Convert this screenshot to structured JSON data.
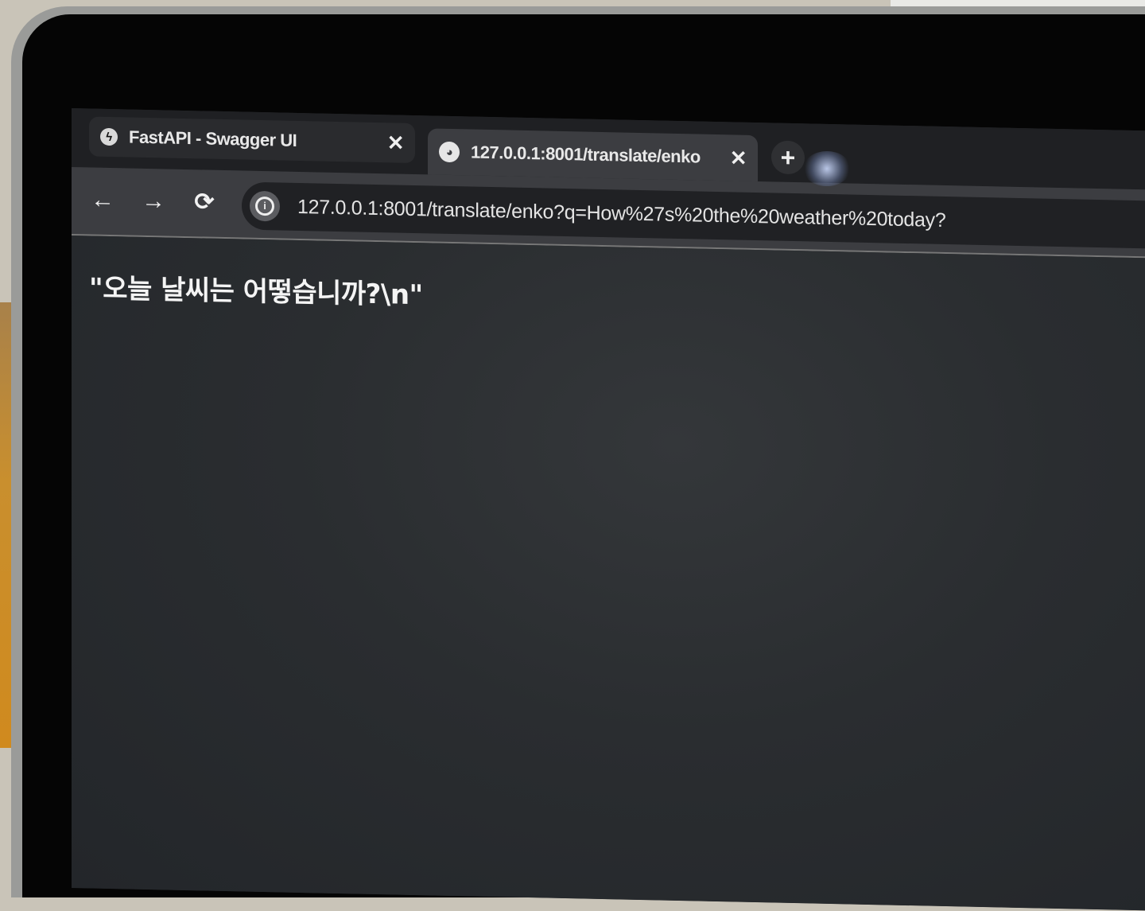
{
  "tabs": [
    {
      "title": "FastAPI - Swagger UI",
      "favicon": "fastapi-icon",
      "close": "✕",
      "active": false
    },
    {
      "title": "127.0.0.1:8001/translate/enko",
      "favicon": "globe-icon",
      "close": "✕",
      "active": true
    }
  ],
  "new_tab": "+",
  "nav": {
    "back": "←",
    "forward": "→",
    "reload": "⟳"
  },
  "address_bar": {
    "icon": "info-icon",
    "url": "127.0.0.1:8001/translate/enko?q=How%27s%20the%20weather%20today?"
  },
  "page": {
    "response_text": "\"오늘 날씨는 어떻습니까?\\n\""
  }
}
